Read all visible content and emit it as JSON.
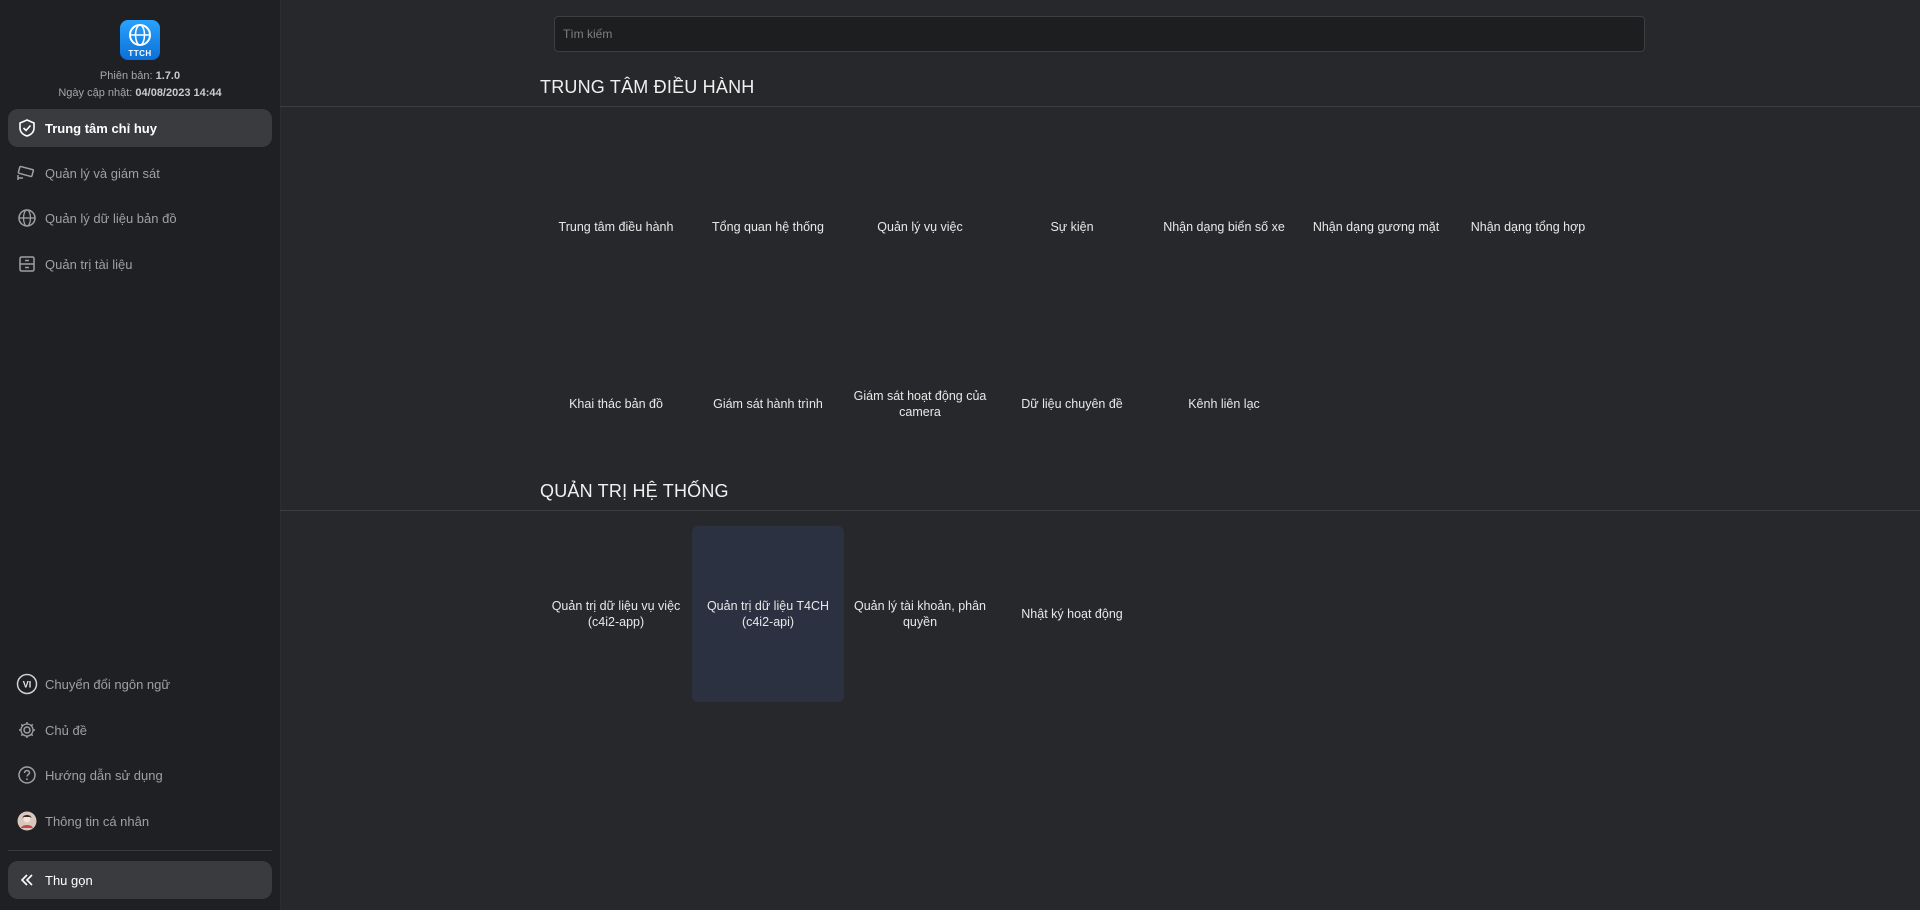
{
  "app": {
    "logo_text": "TTCH",
    "version_label": "Phiên bản:",
    "version_value": "1.7.0",
    "updated_label": "Ngày cập nhật:",
    "updated_value": "04/08/2023 14:44"
  },
  "sidebar": {
    "items": [
      {
        "label": "Trung tâm chỉ huy",
        "icon": "shield-check-icon",
        "active": true
      },
      {
        "label": "Quản lý và giám sát",
        "icon": "cctv-camera-icon"
      },
      {
        "label": "Quản lý dữ liệu bản đồ",
        "icon": "globe-icon"
      },
      {
        "label": "Quản trị tài liệu",
        "icon": "archive-icon"
      }
    ],
    "bottom": [
      {
        "label": "Chuyển đổi ngôn ngữ",
        "icon": "language-vi-icon",
        "badge": "VI"
      },
      {
        "label": "Chủ đề",
        "icon": "gear-icon"
      },
      {
        "label": "Hướng dẫn sử dụng",
        "icon": "help-circle-icon"
      },
      {
        "label": "Thông tin cá nhân",
        "icon": "avatar-icon"
      }
    ],
    "collapse_label": "Thu gọn"
  },
  "search": {
    "placeholder": "Tìm kiếm",
    "value": ""
  },
  "sections": [
    {
      "title": "TRUNG TÂM ĐIỀU HÀNH",
      "tiles": [
        "Trung tâm điều hành",
        "Tổng quan hệ thống",
        "Quản lý vụ việc",
        "Sự kiện",
        "Nhận dạng biển số xe",
        "Nhận dạng gương mặt",
        "Nhận dạng tổng hợp",
        "Khai thác bản đồ",
        "Giám sát hành trình",
        "Giám sát hoạt động của camera",
        "Dữ liệu chuyên đề",
        "Kênh liên lạc"
      ]
    },
    {
      "title": "QUẢN TRỊ HỆ THỐNG",
      "tiles": [
        "Quản trị dữ liệu vụ việc (c4i2-app)",
        "Quản trị dữ liệu T4CH (c4i2-api)",
        "Quản lý tài khoản, phân quyền",
        "Nhật ký hoạt động"
      ]
    }
  ],
  "colors": {
    "background": "#27282b",
    "sidebar": "#1f2023",
    "active_item": "#3a3b3f",
    "tile_hover": "#2b3140",
    "logo_blue": "#1a8ff0"
  }
}
